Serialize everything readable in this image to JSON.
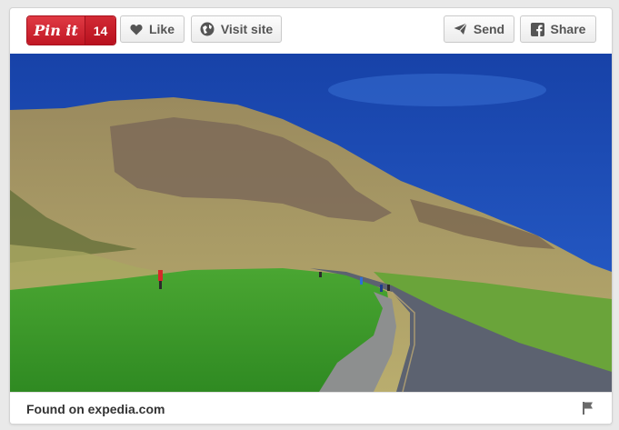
{
  "pin_button": {
    "label": "Pin it",
    "count": "14"
  },
  "toolbar": {
    "like_label": "Like",
    "visit_label": "Visit site",
    "send_label": "Send",
    "share_label": "Share"
  },
  "footer": {
    "found_text": "Found on expedia.com"
  },
  "icons": {
    "like": "heart-icon",
    "visit": "visit-site-icon",
    "send": "paper-plane-icon",
    "share": "facebook-icon",
    "report": "flag-icon"
  },
  "colors": {
    "pin_red": "#c92228",
    "sky": "#1f4fb8",
    "grass": "#3f9a2c"
  }
}
